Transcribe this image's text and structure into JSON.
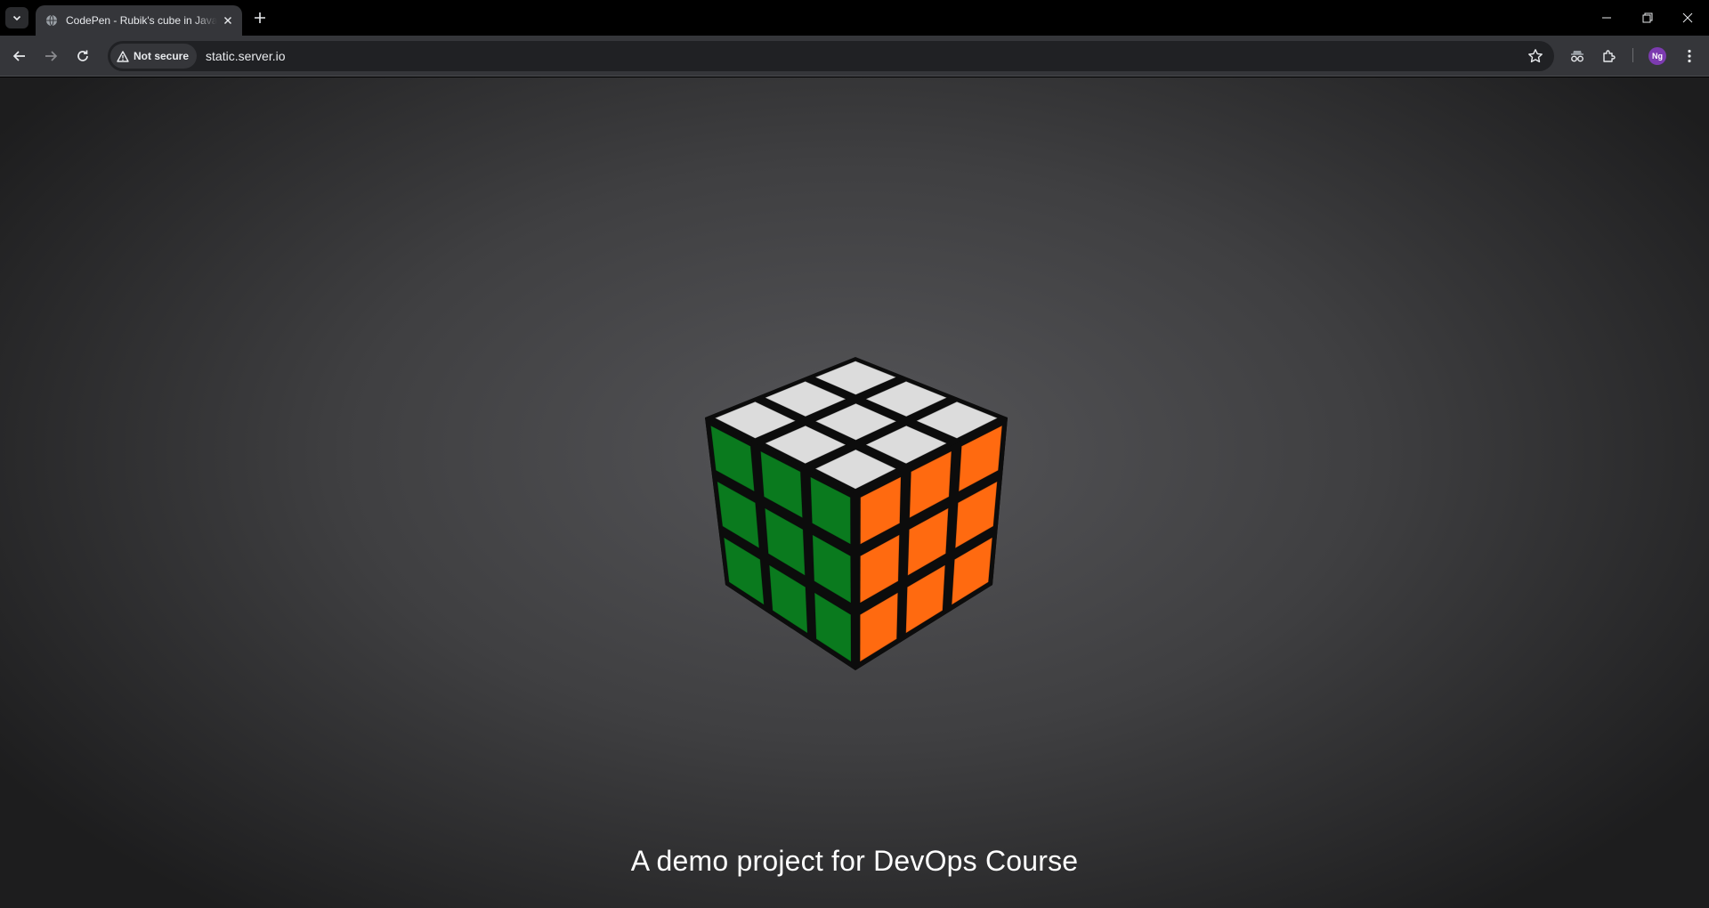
{
  "browser": {
    "tab": {
      "title": "CodePen - Rubik's cube in JavaScript"
    },
    "omnibox": {
      "security_label": "Not secure",
      "url": "static.server.io"
    },
    "profile": {
      "initials": "Ng"
    }
  },
  "page": {
    "caption": "A demo project for DevOps Course"
  },
  "cube": {
    "top_color": "#dcdcdc",
    "left_color": "#0a7a1e",
    "right_color": "#ff6a10",
    "body_color": "#0c0c0c"
  }
}
